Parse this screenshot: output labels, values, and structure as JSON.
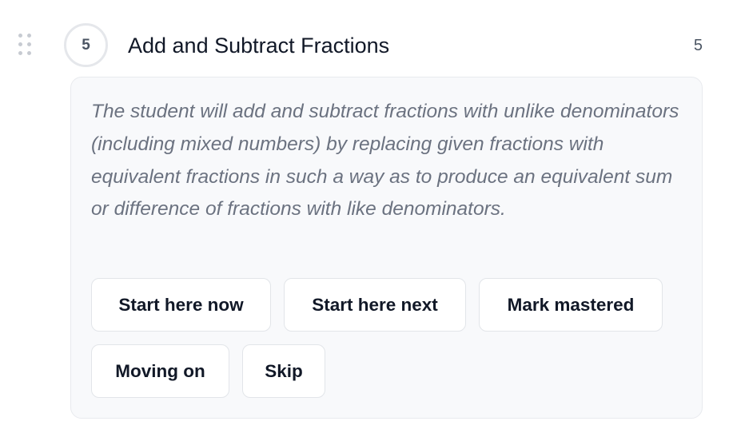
{
  "item": {
    "number": "5",
    "title": "Add and Subtract Fractions",
    "count": "5",
    "description": "The student will add and subtract fractions with unlike denominators (including mixed numbers) by replacing given fractions with equivalent fractions in such a way as to produce an equivalent sum or difference of fractions with like denominators."
  },
  "actions": {
    "start_now_label": "Start here now",
    "start_next_label": "Start here next",
    "mark_mastered_label": "Mark mastered",
    "moving_on_label": "Moving on",
    "skip_label": "Skip"
  },
  "icons": {
    "drag_handle": "drag-handle-icon"
  },
  "colors": {
    "card_background": "#f8f9fb",
    "description_text": "#6b7280",
    "title_text": "#111827",
    "button_border": "#e2e5e9"
  }
}
